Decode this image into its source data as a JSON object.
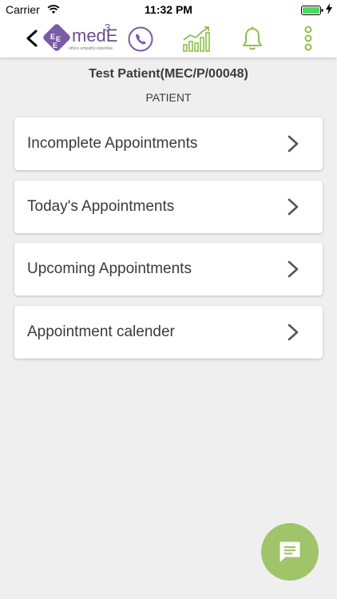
{
  "status_bar": {
    "carrier": "Carrier",
    "time": "11:32 PM"
  },
  "nav": {
    "logo_text": "medE",
    "logo_superscript": "3",
    "logo_tagline": "ethics empathy expertise",
    "icons": [
      "back-chevron-icon",
      "phone-icon",
      "chart-icon",
      "bell-icon",
      "more-vertical-icon"
    ],
    "accent_purple": "#7b5aa6",
    "accent_green": "#8cbf4a"
  },
  "patient": {
    "name": "Test  Patient(MEC/P/00048)",
    "role": "PATIENT"
  },
  "menu": [
    {
      "label": "Incomplete Appointments"
    },
    {
      "label": "Today's Appointments"
    },
    {
      "label": "Upcoming Appointments"
    },
    {
      "label": "Appointment calender"
    }
  ],
  "fab": {
    "icon": "chat-icon",
    "color": "#a0c46a"
  }
}
